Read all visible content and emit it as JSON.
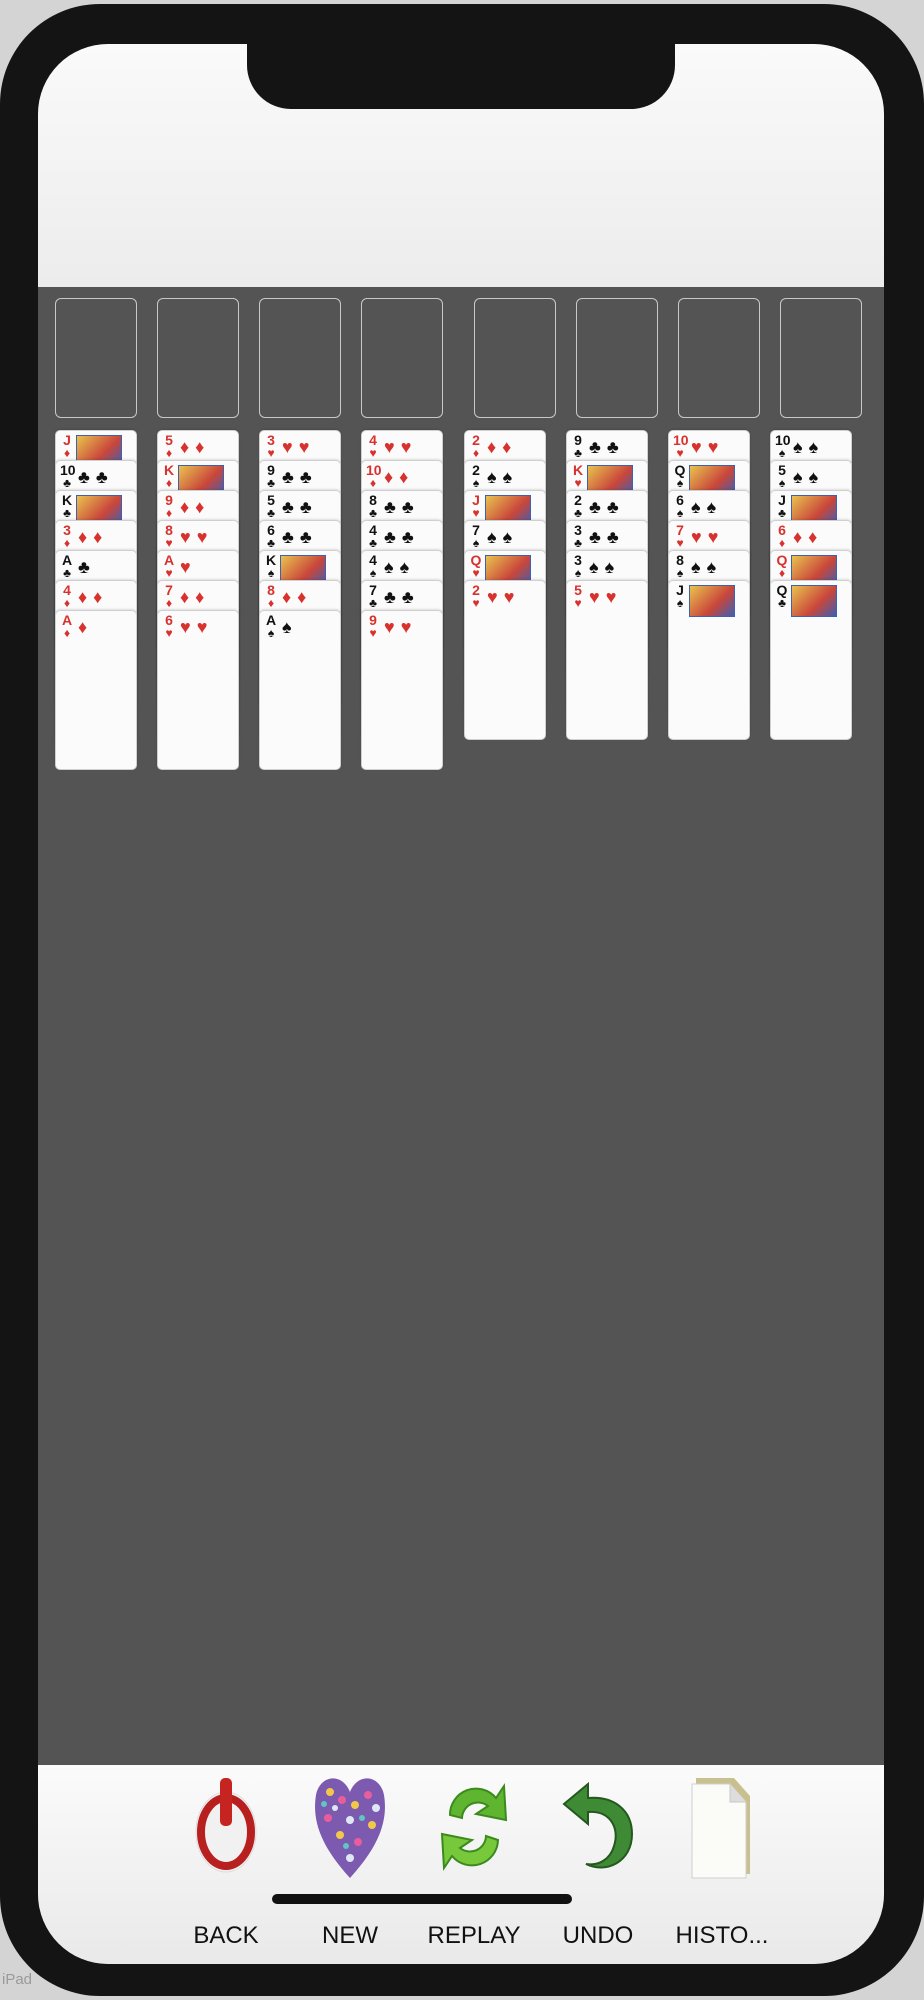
{
  "device_label": "iPad",
  "colors": {
    "table": "#545454",
    "red_suit": "#d8322e",
    "black_suit": "#111111"
  },
  "foundations": [
    {
      "empty": true
    },
    {
      "empty": true
    },
    {
      "empty": true
    },
    {
      "empty": true
    }
  ],
  "free_cells": [
    {
      "empty": true
    },
    {
      "empty": true
    },
    {
      "empty": true
    },
    {
      "empty": true
    }
  ],
  "tableau": [
    [
      {
        "rank": "J",
        "suit": "♦"
      },
      {
        "rank": "10",
        "suit": "♣"
      },
      {
        "rank": "K",
        "suit": "♣"
      },
      {
        "rank": "3",
        "suit": "♦"
      },
      {
        "rank": "A",
        "suit": "♣"
      },
      {
        "rank": "4",
        "suit": "♦"
      },
      {
        "rank": "A",
        "suit": "♦"
      }
    ],
    [
      {
        "rank": "5",
        "suit": "♦"
      },
      {
        "rank": "K",
        "suit": "♦"
      },
      {
        "rank": "9",
        "suit": "♦"
      },
      {
        "rank": "8",
        "suit": "♥"
      },
      {
        "rank": "A",
        "suit": "♥"
      },
      {
        "rank": "7",
        "suit": "♦"
      },
      {
        "rank": "6",
        "suit": "♥"
      }
    ],
    [
      {
        "rank": "3",
        "suit": "♥"
      },
      {
        "rank": "9",
        "suit": "♣"
      },
      {
        "rank": "5",
        "suit": "♣"
      },
      {
        "rank": "6",
        "suit": "♣"
      },
      {
        "rank": "K",
        "suit": "♠"
      },
      {
        "rank": "8",
        "suit": "♦"
      },
      {
        "rank": "A",
        "suit": "♠"
      }
    ],
    [
      {
        "rank": "4",
        "suit": "♥"
      },
      {
        "rank": "10",
        "suit": "♦"
      },
      {
        "rank": "8",
        "suit": "♣"
      },
      {
        "rank": "4",
        "suit": "♣"
      },
      {
        "rank": "4",
        "suit": "♠"
      },
      {
        "rank": "7",
        "suit": "♣"
      },
      {
        "rank": "9",
        "suit": "♥"
      }
    ],
    [
      {
        "rank": "2",
        "suit": "♦"
      },
      {
        "rank": "2",
        "suit": "♠"
      },
      {
        "rank": "J",
        "suit": "♥"
      },
      {
        "rank": "7",
        "suit": "♠"
      },
      {
        "rank": "Q",
        "suit": "♥"
      },
      {
        "rank": "2",
        "suit": "♥"
      }
    ],
    [
      {
        "rank": "9",
        "suit": "♣"
      },
      {
        "rank": "K",
        "suit": "♥"
      },
      {
        "rank": "2",
        "suit": "♣"
      },
      {
        "rank": "3",
        "suit": "♣"
      },
      {
        "rank": "3",
        "suit": "♠"
      },
      {
        "rank": "5",
        "suit": "♥"
      }
    ],
    [
      {
        "rank": "10",
        "suit": "♥"
      },
      {
        "rank": "Q",
        "suit": "♠"
      },
      {
        "rank": "6",
        "suit": "♠"
      },
      {
        "rank": "7",
        "suit": "♥"
      },
      {
        "rank": "8",
        "suit": "♠"
      },
      {
        "rank": "J",
        "suit": "♠"
      }
    ],
    [
      {
        "rank": "10",
        "suit": "♠"
      },
      {
        "rank": "5",
        "suit": "♠"
      },
      {
        "rank": "J",
        "suit": "♣"
      },
      {
        "rank": "6",
        "suit": "♦"
      },
      {
        "rank": "Q",
        "suit": "♦"
      },
      {
        "rank": "Q",
        "suit": "♣"
      }
    ]
  ],
  "toolbar": {
    "back": {
      "label": "BACK",
      "icon": "power-icon"
    },
    "new": {
      "label": "NEW",
      "icon": "polka-heart-icon"
    },
    "replay": {
      "label": "REPLAY",
      "icon": "refresh-arrows-icon"
    },
    "undo": {
      "label": "UNDO",
      "icon": "undo-arrow-icon"
    },
    "history": {
      "label": "HISTO...",
      "icon": "document-icon"
    }
  }
}
